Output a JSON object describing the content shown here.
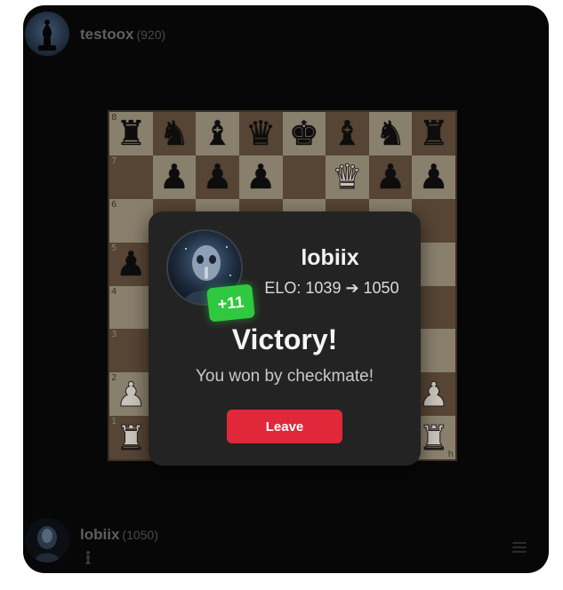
{
  "top_player": {
    "name": "testoox",
    "elo": "(920)",
    "avatar": "black-bishop-avatar-icon"
  },
  "bottom_player": {
    "name": "lobiix",
    "elo": "(1050)",
    "avatar": "hooded-figure-avatar-icon",
    "captured": [
      "white-pawn-icon"
    ]
  },
  "board": {
    "ranks": [
      [
        "bR",
        "bN",
        "bB",
        "bQ",
        "bK",
        "bB",
        "bN",
        "bR"
      ],
      [
        "",
        "bP",
        "bP",
        "bP",
        "",
        "wQ",
        "bP",
        "bP"
      ],
      [
        "",
        "",
        "",
        "",
        "",
        "",
        "",
        ""
      ],
      [
        "bP",
        "",
        "",
        "",
        "",
        "",
        "",
        ""
      ],
      [
        "",
        "",
        "",
        "",
        "",
        "",
        "",
        ""
      ],
      [
        "",
        "",
        "",
        "",
        "",
        "",
        "",
        ""
      ],
      [
        "wP",
        "",
        "",
        "",
        "",
        "",
        "",
        "wP"
      ],
      [
        "wR",
        "",
        "",
        "",
        "",
        "",
        "",
        "wR"
      ]
    ],
    "rank_labels": [
      "8",
      "7",
      "6",
      "5",
      "4",
      "3",
      "2",
      "1"
    ],
    "file_labels": [
      "a",
      "b",
      "c",
      "d",
      "e",
      "f",
      "g",
      "h"
    ],
    "light_color": "#a89c86",
    "dark_color": "#6a5340"
  },
  "result_modal": {
    "player_name": "lobiix",
    "elo_change": "+11",
    "elo_line": "ELO: 1039 ➔ 1050",
    "title": "Victory!",
    "subtitle": "You won by checkmate!",
    "leave_label": "Leave",
    "accent_color": "#e0283a",
    "badge_color": "#2fc93f"
  }
}
